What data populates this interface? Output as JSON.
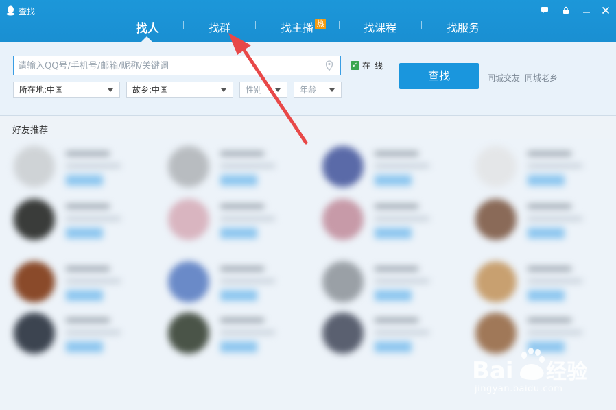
{
  "window": {
    "title": "查找",
    "controls": [
      "feedback-icon",
      "lock-icon",
      "minimize-icon",
      "close-icon"
    ]
  },
  "nav": {
    "tabs": [
      {
        "label": "找人",
        "active": true
      },
      {
        "label": "找群",
        "active": false
      },
      {
        "label": "找主播",
        "active": false,
        "badge": "热"
      },
      {
        "label": "找课程",
        "active": false
      },
      {
        "label": "找服务",
        "active": false
      }
    ]
  },
  "search": {
    "placeholder": "请输入QQ号/手机号/邮箱/昵称/关键词",
    "value": "",
    "online_label": "在线",
    "online_checked": true,
    "button_label": "查找",
    "filters": {
      "location": "所在地:中国",
      "hometown": "故乡:中国",
      "gender": "性别",
      "age": "年龄"
    },
    "links": [
      "同城交友",
      "同城老乡"
    ]
  },
  "recommendations": {
    "title": "好友推荐"
  },
  "watermark": {
    "url": "jingyan.baidu.com"
  },
  "colors": {
    "titlebar": "#1a8fd2",
    "accent": "#1a96dd",
    "arrow": "#e84848",
    "online_check": "#3aa650",
    "hot_badge": "#f39c12"
  }
}
